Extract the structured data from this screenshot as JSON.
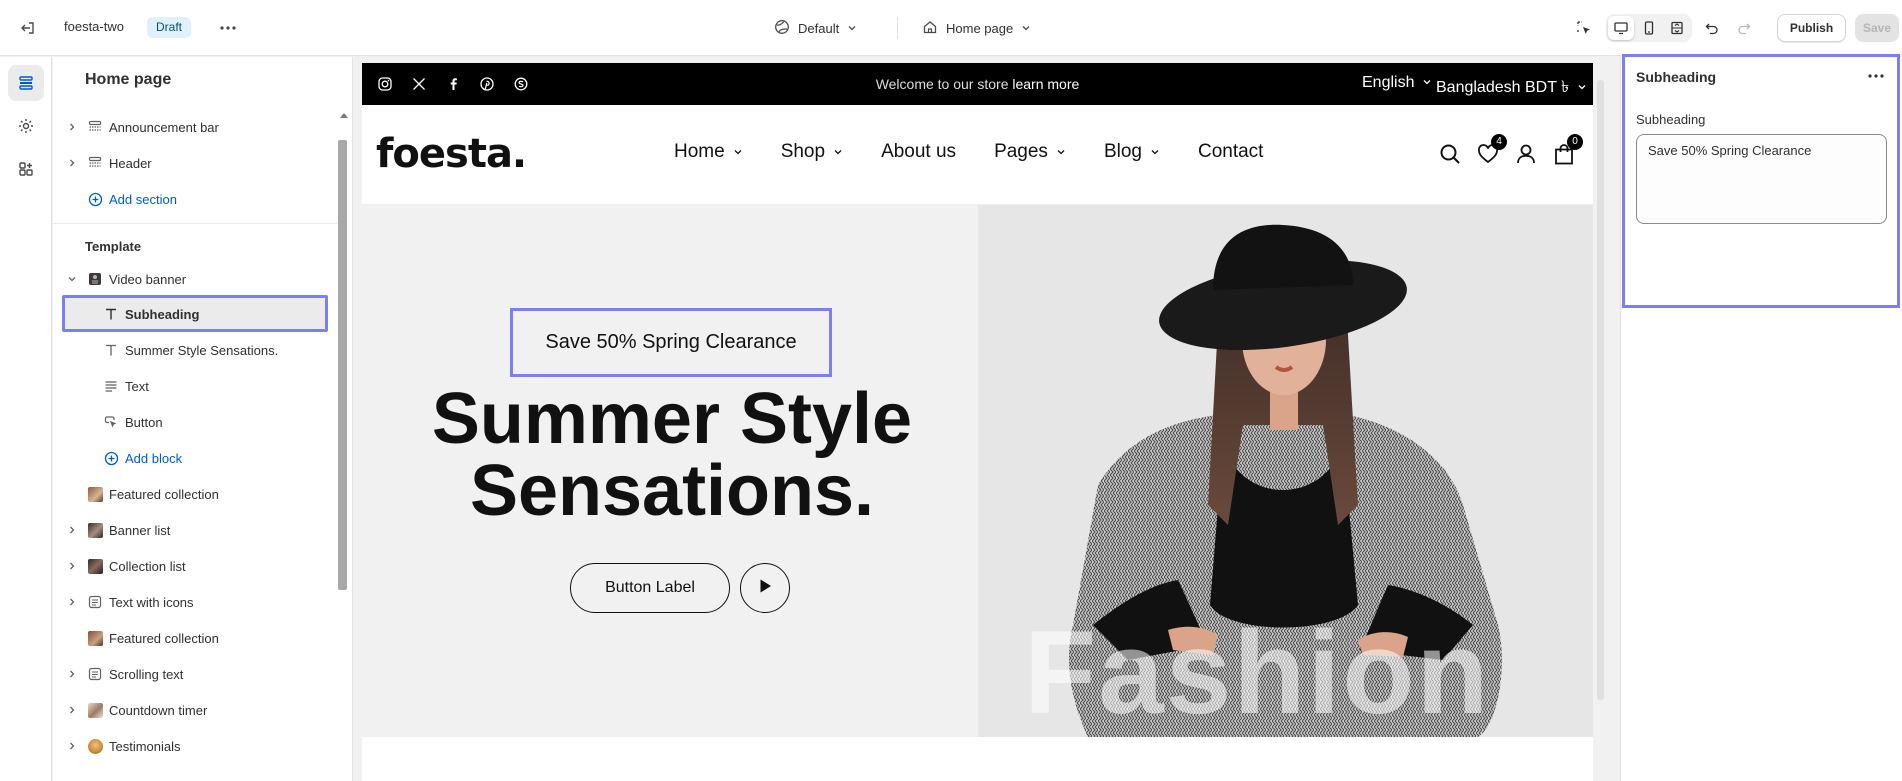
{
  "topbar": {
    "store_name": "foesta-two",
    "status_badge": "Draft",
    "theme_selector": "Default",
    "page_selector": "Home page",
    "publish_label": "Publish",
    "save_label": "Save"
  },
  "sidebar": {
    "title": "Home page",
    "header_group": [
      {
        "label": "Announcement bar",
        "icon": "section-icon",
        "expandable": true
      },
      {
        "label": "Header",
        "icon": "section-icon",
        "expandable": true
      }
    ],
    "add_section_header": "Add section",
    "template_label": "Template",
    "video_banner": {
      "label": "Video banner",
      "expanded": true,
      "blocks": [
        {
          "label": "Subheading",
          "icon": "text-icon",
          "selected": true
        },
        {
          "label": "Summer Style Sensations.",
          "icon": "text-icon"
        },
        {
          "label": "Text",
          "icon": "paragraph-icon"
        },
        {
          "label": "Button",
          "icon": "button-icon"
        }
      ],
      "add_block": "Add block"
    },
    "sections": [
      {
        "label": "Featured collection",
        "icon": "image-thumb-icon",
        "expandable": false
      },
      {
        "label": "Banner list",
        "icon": "image-thumb-icon",
        "expandable": true
      },
      {
        "label": "Collection list",
        "icon": "image-thumb-icon",
        "expandable": true
      },
      {
        "label": "Text with icons",
        "icon": "section-list-icon",
        "expandable": true
      },
      {
        "label": "Featured collection",
        "icon": "image-thumb-icon",
        "expandable": false
      },
      {
        "label": "Scrolling text",
        "icon": "section-list-icon",
        "expandable": true
      },
      {
        "label": "Countdown timer",
        "icon": "image-thumb-icon",
        "expandable": true
      },
      {
        "label": "Testimonials",
        "icon": "image-thumb-icon",
        "expandable": true
      }
    ]
  },
  "store": {
    "announcement": {
      "text": "Welcome to our store",
      "link": "learn more",
      "language": "English",
      "currency": "Bangladesh BDT ৳"
    },
    "logo": "foesta.",
    "nav": [
      {
        "label": "Home",
        "dropdown": true
      },
      {
        "label": "Shop",
        "dropdown": true
      },
      {
        "label": "About us",
        "dropdown": false
      },
      {
        "label": "Pages",
        "dropdown": true
      },
      {
        "label": "Blog",
        "dropdown": true
      },
      {
        "label": "Contact",
        "dropdown": false
      }
    ],
    "wishlist_count": "4",
    "cart_count": "0",
    "hero": {
      "subheading": "Save 50% Spring Clearance",
      "title_line1": "Summer Style",
      "title_line2": "Sensations.",
      "button_label": "Button Label",
      "watermark": "Fashion"
    }
  },
  "panel": {
    "title": "Subheading",
    "field_label": "Subheading",
    "field_value": "Save 50% Spring Clearance"
  },
  "colors": {
    "selection_outline": "#7b7ff2",
    "link_blue": "#005bd3",
    "draft_badge_bg": "#e0f0ff"
  }
}
